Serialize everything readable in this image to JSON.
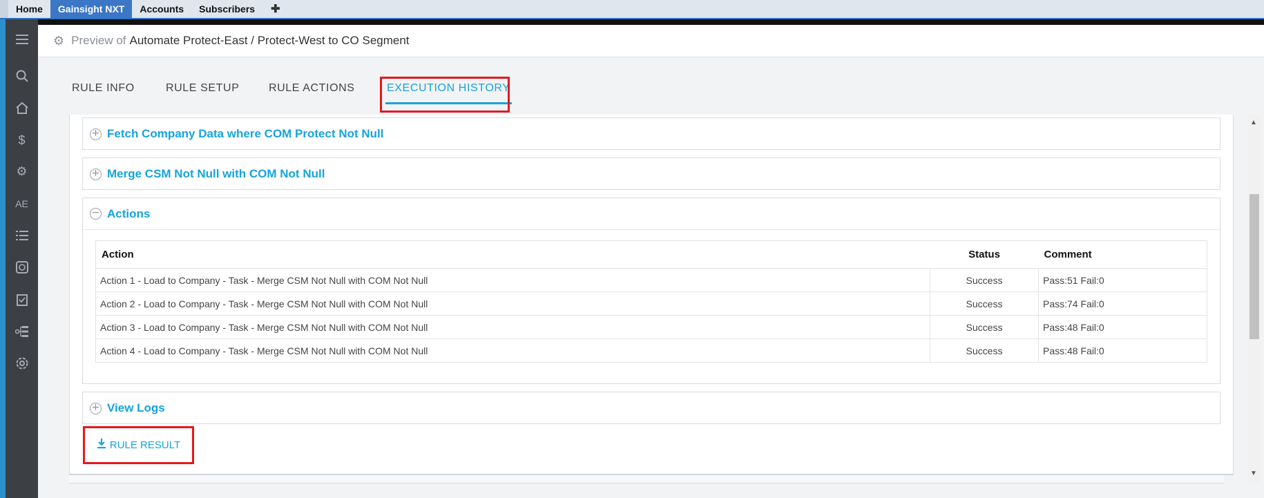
{
  "topbar": {
    "tabs": [
      {
        "label": "Home"
      },
      {
        "label": "Gainsight NXT"
      },
      {
        "label": "Accounts"
      },
      {
        "label": "Subscribers"
      }
    ],
    "add_label": "✚"
  },
  "sidebar": {
    "items": [
      {
        "icon": "menu-icon"
      },
      {
        "icon": "search-icon"
      },
      {
        "icon": "home-icon"
      },
      {
        "icon": "dollar-icon"
      },
      {
        "icon": "settings-badge-icon"
      },
      {
        "icon": "ae-label",
        "text": "AE"
      },
      {
        "icon": "list-icon"
      },
      {
        "icon": "clock-icon"
      },
      {
        "icon": "clipboard-icon"
      },
      {
        "icon": "hierarchy-icon"
      },
      {
        "icon": "gear-icon"
      }
    ]
  },
  "header": {
    "prefix": "Preview of",
    "rule_name": "Automate Protect-East / Protect-West to CO Segment"
  },
  "rule_tabs": [
    {
      "label": "RULE INFO"
    },
    {
      "label": "RULE SETUP"
    },
    {
      "label": "RULE ACTIONS"
    },
    {
      "label": "EXECUTION HISTORY"
    }
  ],
  "sections": {
    "fetch": "Fetch Company Data where COM Protect Not Null",
    "merge": "Merge CSM Not Null with COM Not Null",
    "actions": "Actions",
    "logs": "View Logs"
  },
  "actions_table": {
    "headers": {
      "action": "Action",
      "status": "Status",
      "comment": "Comment"
    },
    "rows": [
      {
        "action": "Action 1 - Load to Company - Task - Merge CSM Not Null with COM Not Null",
        "status": "Success",
        "comment": "Pass:51 Fail:0"
      },
      {
        "action": "Action 2 - Load to Company - Task - Merge CSM Not Null with COM Not Null",
        "status": "Success",
        "comment": "Pass:74 Fail:0"
      },
      {
        "action": "Action 3 - Load to Company - Task - Merge CSM Not Null with COM Not Null",
        "status": "Success",
        "comment": "Pass:48 Fail:0"
      },
      {
        "action": "Action 4 - Load to Company - Task - Merge CSM Not Null with COM Not Null",
        "status": "Success",
        "comment": "Pass:48 Fail:0"
      }
    ]
  },
  "rule_result_label": "RULE RESULT",
  "colors": {
    "accent": "#16a3dd",
    "highlight": "#e6171d",
    "sidebar": "#3c3f44"
  }
}
